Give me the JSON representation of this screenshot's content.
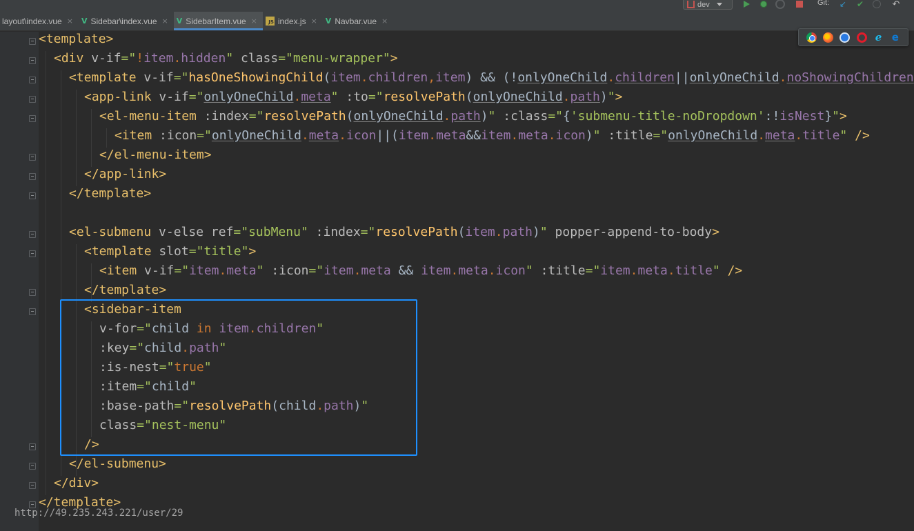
{
  "toolbar": {
    "branch": "dev",
    "git_label": "Git:",
    "git_update_glyph": "↙",
    "git_commit_glyph": "✔",
    "git_revert_glyph": "↶"
  },
  "tabs": [
    {
      "label": "layout\\index.vue",
      "icon": "vue-icon",
      "active": false
    },
    {
      "label": "Sidebar\\index.vue",
      "icon": "vue-icon",
      "active": false
    },
    {
      "label": "SidebarItem.vue",
      "icon": "vue-icon",
      "active": true
    },
    {
      "label": "index.js",
      "icon": "js-icon",
      "active": false
    },
    {
      "label": "Navbar.vue",
      "icon": "vue-icon",
      "active": false
    }
  ],
  "tab_close_glyph": "×",
  "js_icon_text": "JS",
  "vue_icon_glyph": "V",
  "editor": {
    "lines": [
      {
        "indent": 0,
        "tokens": [
          [
            "t-tag",
            "<template>"
          ]
        ]
      },
      {
        "indent": 1,
        "tokens": [
          [
            "t-tag",
            "<div "
          ],
          [
            "t-attr",
            "v-if"
          ],
          [
            "t-str",
            "=\""
          ],
          [
            "t-kw",
            "!"
          ],
          [
            "t-prop",
            "item"
          ],
          [
            "t-kw",
            "."
          ],
          [
            "t-prop",
            "hidden"
          ],
          [
            "t-str",
            "\" "
          ],
          [
            "t-attr",
            "class"
          ],
          [
            "t-str",
            "=\"menu-wrapper\""
          ],
          [
            "t-tag",
            ">"
          ]
        ]
      },
      {
        "indent": 2,
        "tokens": [
          [
            "t-tag",
            "<template "
          ],
          [
            "t-attr",
            "v-if"
          ],
          [
            "t-str",
            "=\""
          ],
          [
            "t-fn",
            "hasOneShowingChild"
          ],
          [
            "t-plain",
            "("
          ],
          [
            "t-prop",
            "item"
          ],
          [
            "t-kw",
            "."
          ],
          [
            "t-prop",
            "children"
          ],
          [
            "t-kw",
            ","
          ],
          [
            "t-prop",
            "item"
          ],
          [
            "t-plain",
            ") && (!"
          ],
          [
            "t-ident t-under",
            "onlyOneChild"
          ],
          [
            "t-kw",
            "."
          ],
          [
            "t-prop t-under",
            "children"
          ],
          [
            "t-plain",
            "||"
          ],
          [
            "t-ident t-under",
            "onlyOneChild"
          ],
          [
            "t-kw",
            "."
          ],
          [
            "t-prop t-under",
            "noShowingChildren"
          ]
        ]
      },
      {
        "indent": 3,
        "tokens": [
          [
            "t-tag",
            "<app-link "
          ],
          [
            "t-attr",
            "v-if"
          ],
          [
            "t-str",
            "=\""
          ],
          [
            "t-ident t-under",
            "onlyOneChild"
          ],
          [
            "t-kw",
            "."
          ],
          [
            "t-prop t-under",
            "meta"
          ],
          [
            "t-str",
            "\" "
          ],
          [
            "t-attr",
            ":to"
          ],
          [
            "t-str",
            "=\""
          ],
          [
            "t-fn",
            "resolvePath"
          ],
          [
            "t-plain",
            "("
          ],
          [
            "t-ident t-under",
            "onlyOneChild"
          ],
          [
            "t-kw",
            "."
          ],
          [
            "t-prop t-under",
            "path"
          ],
          [
            "t-plain",
            ")"
          ],
          [
            "t-str",
            "\""
          ],
          [
            "t-tag",
            ">"
          ]
        ]
      },
      {
        "indent": 4,
        "tokens": [
          [
            "t-tag",
            "<el-menu-item "
          ],
          [
            "t-attr",
            ":index"
          ],
          [
            "t-str",
            "=\""
          ],
          [
            "t-fn",
            "resolvePath"
          ],
          [
            "t-plain",
            "("
          ],
          [
            "t-ident t-under",
            "onlyOneChild"
          ],
          [
            "t-kw",
            "."
          ],
          [
            "t-prop t-under",
            "path"
          ],
          [
            "t-plain",
            ")"
          ],
          [
            "t-str",
            "\" "
          ],
          [
            "t-attr",
            ":class"
          ],
          [
            "t-str",
            "=\""
          ],
          [
            "t-plain",
            "{"
          ],
          [
            "t-str",
            "'submenu-title-noDropdown'"
          ],
          [
            "t-plain",
            ":!"
          ],
          [
            "t-prop",
            "isNest"
          ],
          [
            "t-plain",
            "}"
          ],
          [
            "t-str",
            "\""
          ],
          [
            "t-tag",
            ">"
          ]
        ]
      },
      {
        "indent": 5,
        "tokens": [
          [
            "t-tag",
            "<item "
          ],
          [
            "t-attr",
            ":icon"
          ],
          [
            "t-str",
            "=\""
          ],
          [
            "t-ident t-under",
            "onlyOneChild"
          ],
          [
            "t-kw",
            "."
          ],
          [
            "t-prop t-under",
            "meta"
          ],
          [
            "t-kw",
            "."
          ],
          [
            "t-prop",
            "icon"
          ],
          [
            "t-plain",
            "||("
          ],
          [
            "t-prop",
            "item"
          ],
          [
            "t-kw",
            "."
          ],
          [
            "t-prop",
            "meta"
          ],
          [
            "t-plain",
            "&&"
          ],
          [
            "t-prop",
            "item"
          ],
          [
            "t-kw",
            "."
          ],
          [
            "t-prop",
            "meta"
          ],
          [
            "t-kw",
            "."
          ],
          [
            "t-prop",
            "icon"
          ],
          [
            "t-plain",
            ")"
          ],
          [
            "t-str",
            "\" "
          ],
          [
            "t-attr",
            ":title"
          ],
          [
            "t-str",
            "=\""
          ],
          [
            "t-ident t-under",
            "onlyOneChild"
          ],
          [
            "t-kw",
            "."
          ],
          [
            "t-prop t-under",
            "meta"
          ],
          [
            "t-kw",
            "."
          ],
          [
            "t-prop",
            "title"
          ],
          [
            "t-str",
            "\" "
          ],
          [
            "t-tag",
            "/>"
          ]
        ]
      },
      {
        "indent": 4,
        "tokens": [
          [
            "t-tag",
            "</el-menu-item>"
          ]
        ]
      },
      {
        "indent": 3,
        "tokens": [
          [
            "t-tag",
            "</app-link>"
          ]
        ]
      },
      {
        "indent": 2,
        "tokens": [
          [
            "t-tag",
            "</template>"
          ]
        ]
      },
      {
        "indent": 0,
        "tokens": []
      },
      {
        "indent": 2,
        "tokens": [
          [
            "t-tag",
            "<el-submenu "
          ],
          [
            "t-attr",
            "v-else ref"
          ],
          [
            "t-str",
            "=\"subMenu\" "
          ],
          [
            "t-attr",
            ":index"
          ],
          [
            "t-str",
            "=\""
          ],
          [
            "t-fn",
            "resolvePath"
          ],
          [
            "t-plain",
            "("
          ],
          [
            "t-prop",
            "item"
          ],
          [
            "t-kw",
            "."
          ],
          [
            "t-prop",
            "path"
          ],
          [
            "t-plain",
            ")"
          ],
          [
            "t-str",
            "\" "
          ],
          [
            "t-attr",
            "popper-append-to-body"
          ],
          [
            "t-tag",
            ">"
          ]
        ]
      },
      {
        "indent": 3,
        "tokens": [
          [
            "t-tag",
            "<template "
          ],
          [
            "t-attr",
            "slot"
          ],
          [
            "t-str",
            "=\"title\""
          ],
          [
            "t-tag",
            ">"
          ]
        ]
      },
      {
        "indent": 4,
        "tokens": [
          [
            "t-tag",
            "<item "
          ],
          [
            "t-attr",
            "v-if"
          ],
          [
            "t-str",
            "=\""
          ],
          [
            "t-prop",
            "item"
          ],
          [
            "t-kw",
            "."
          ],
          [
            "t-prop",
            "meta"
          ],
          [
            "t-str",
            "\" "
          ],
          [
            "t-attr",
            ":icon"
          ],
          [
            "t-str",
            "=\""
          ],
          [
            "t-prop",
            "item"
          ],
          [
            "t-kw",
            "."
          ],
          [
            "t-prop",
            "meta"
          ],
          [
            "t-plain",
            " && "
          ],
          [
            "t-prop",
            "item"
          ],
          [
            "t-kw",
            "."
          ],
          [
            "t-prop",
            "meta"
          ],
          [
            "t-kw",
            "."
          ],
          [
            "t-prop",
            "icon"
          ],
          [
            "t-str",
            "\" "
          ],
          [
            "t-attr",
            ":title"
          ],
          [
            "t-str",
            "=\""
          ],
          [
            "t-prop",
            "item"
          ],
          [
            "t-kw",
            "."
          ],
          [
            "t-prop",
            "meta"
          ],
          [
            "t-kw",
            "."
          ],
          [
            "t-prop",
            "title"
          ],
          [
            "t-str",
            "\" "
          ],
          [
            "t-tag",
            "/>"
          ]
        ]
      },
      {
        "indent": 3,
        "tokens": [
          [
            "t-tag",
            "</template>"
          ]
        ]
      },
      {
        "indent": 3,
        "tokens": [
          [
            "t-tag",
            "<sidebar-item"
          ]
        ]
      },
      {
        "indent": 4,
        "tokens": [
          [
            "t-attr",
            "v-for"
          ],
          [
            "t-str",
            "=\""
          ],
          [
            "t-ident",
            "child "
          ],
          [
            "t-kw",
            "in "
          ],
          [
            "t-prop",
            "item"
          ],
          [
            "t-kw",
            "."
          ],
          [
            "t-prop",
            "children"
          ],
          [
            "t-str",
            "\""
          ]
        ]
      },
      {
        "indent": 4,
        "tokens": [
          [
            "t-attr",
            ":key"
          ],
          [
            "t-str",
            "=\""
          ],
          [
            "t-ident",
            "child"
          ],
          [
            "t-kw",
            "."
          ],
          [
            "t-prop",
            "path"
          ],
          [
            "t-str",
            "\""
          ]
        ]
      },
      {
        "indent": 4,
        "tokens": [
          [
            "t-attr",
            ":is-nest"
          ],
          [
            "t-str",
            "=\""
          ],
          [
            "t-lit",
            "true"
          ],
          [
            "t-str",
            "\""
          ]
        ]
      },
      {
        "indent": 4,
        "tokens": [
          [
            "t-attr",
            ":item"
          ],
          [
            "t-str",
            "=\""
          ],
          [
            "t-ident",
            "child"
          ],
          [
            "t-str",
            "\""
          ]
        ]
      },
      {
        "indent": 4,
        "tokens": [
          [
            "t-attr",
            ":base-path"
          ],
          [
            "t-str",
            "=\""
          ],
          [
            "t-fn",
            "resolvePath"
          ],
          [
            "t-plain",
            "("
          ],
          [
            "t-ident",
            "child"
          ],
          [
            "t-kw",
            "."
          ],
          [
            "t-prop",
            "path"
          ],
          [
            "t-plain",
            ")"
          ],
          [
            "t-str",
            "\""
          ]
        ]
      },
      {
        "indent": 4,
        "tokens": [
          [
            "t-attr",
            "class"
          ],
          [
            "t-str",
            "=\"nest-menu\""
          ]
        ]
      },
      {
        "indent": 3,
        "tokens": [
          [
            "t-tag",
            "/>"
          ]
        ]
      },
      {
        "indent": 2,
        "tokens": [
          [
            "t-tag",
            "</el-submenu>"
          ]
        ]
      },
      {
        "indent": 1,
        "tokens": [
          [
            "t-tag",
            "</div>"
          ]
        ]
      },
      {
        "indent": 0,
        "tokens": [
          [
            "t-tag",
            "</template>"
          ]
        ]
      }
    ]
  },
  "highlight_color": "#1e90ff",
  "browser_icons": [
    "chrome-icon",
    "firefox-icon",
    "safari-icon",
    "opera-icon",
    "ie-icon",
    "edge-icon"
  ],
  "ie_glyph": "e",
  "edge_glyph": "e",
  "watermark": "http://49.235.243.221/user/29"
}
